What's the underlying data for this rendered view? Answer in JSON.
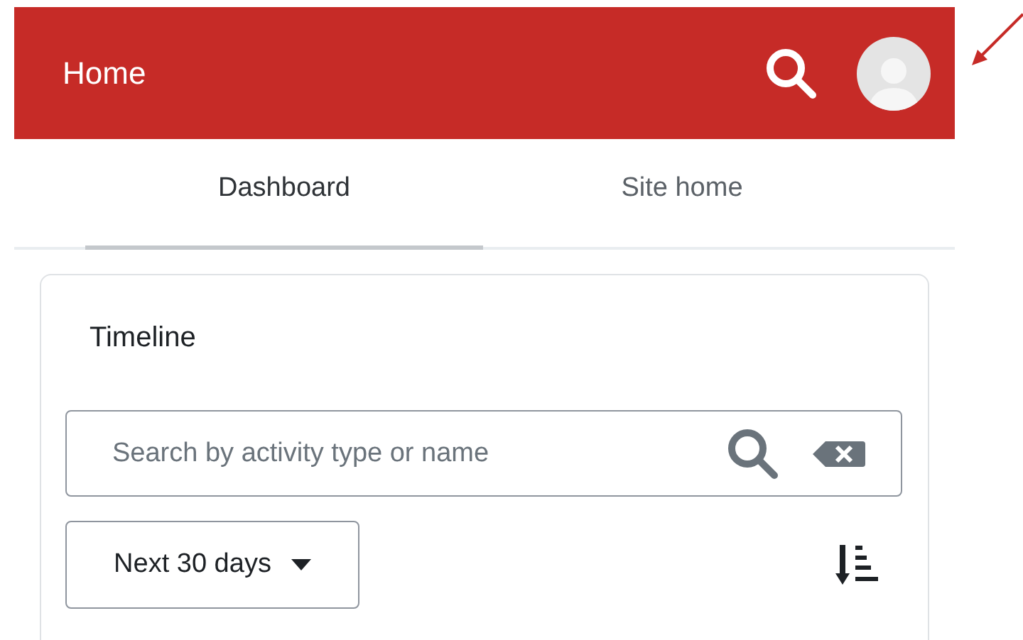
{
  "app_bar": {
    "title": "Home"
  },
  "tabs": [
    {
      "label": "Dashboard",
      "selected": true
    },
    {
      "label": "Site home",
      "selected": false
    }
  ],
  "timeline": {
    "title": "Timeline",
    "search": {
      "placeholder": "Search by activity type or name"
    },
    "filter": {
      "value": "Next 30 days"
    }
  }
}
